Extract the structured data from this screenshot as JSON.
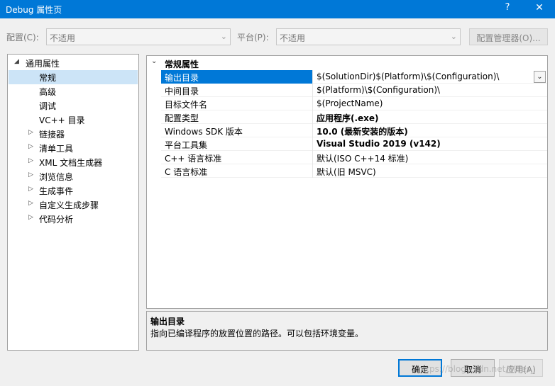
{
  "window": {
    "title": "Debug 属性页",
    "help_glyph": "?",
    "close_glyph": "✕"
  },
  "config_bar": {
    "config_label": "配置(C):",
    "config_value": "不适用",
    "platform_label": "平台(P):",
    "platform_value": "不适用",
    "config_manager_label": "配置管理器(O)..."
  },
  "tree": {
    "items": [
      {
        "label": "通用属性",
        "expander": "◢",
        "level": 0
      },
      {
        "label": "常规",
        "expander": "",
        "level": 1,
        "selected": true
      },
      {
        "label": "高级",
        "expander": "",
        "level": 1
      },
      {
        "label": "调试",
        "expander": "",
        "level": 1
      },
      {
        "label": "VC++ 目录",
        "expander": "",
        "level": 1
      },
      {
        "label": "链接器",
        "expander": "▷",
        "level": 1
      },
      {
        "label": "清单工具",
        "expander": "▷",
        "level": 1
      },
      {
        "label": "XML 文档生成器",
        "expander": "▷",
        "level": 1
      },
      {
        "label": "浏览信息",
        "expander": "▷",
        "level": 1
      },
      {
        "label": "生成事件",
        "expander": "▷",
        "level": 1
      },
      {
        "label": "自定义生成步骤",
        "expander": "▷",
        "level": 1
      },
      {
        "label": "代码分析",
        "expander": "▷",
        "level": 1
      }
    ]
  },
  "grid": {
    "category": "常规属性",
    "properties": [
      {
        "name": "输出目录",
        "value": "$(SolutionDir)$(Platform)\\$(Configuration)\\",
        "bold": false,
        "selected": true
      },
      {
        "name": "中间目录",
        "value": "$(Platform)\\$(Configuration)\\",
        "bold": false
      },
      {
        "name": "目标文件名",
        "value": "$(ProjectName)",
        "bold": false
      },
      {
        "name": "配置类型",
        "value": "应用程序(.exe)",
        "bold": true
      },
      {
        "name": "Windows SDK 版本",
        "value": "10.0 (最新安装的版本)",
        "bold": true
      },
      {
        "name": "平台工具集",
        "value": "Visual Studio 2019 (v142)",
        "bold": true
      },
      {
        "name": "C++ 语言标准",
        "value": "默认(ISO C++14 标准)",
        "bold": false
      },
      {
        "name": "C 语言标准",
        "value": "默认(旧 MSVC)",
        "bold": false
      }
    ]
  },
  "description": {
    "title": "输出目录",
    "text": "指向已编译程序的放置位置的路径。可以包括环境变量。"
  },
  "buttons": {
    "ok": "确定",
    "cancel": "取消",
    "apply": "应用(A)"
  },
  "watermark": "https://blog.csdn.net/Skies_"
}
